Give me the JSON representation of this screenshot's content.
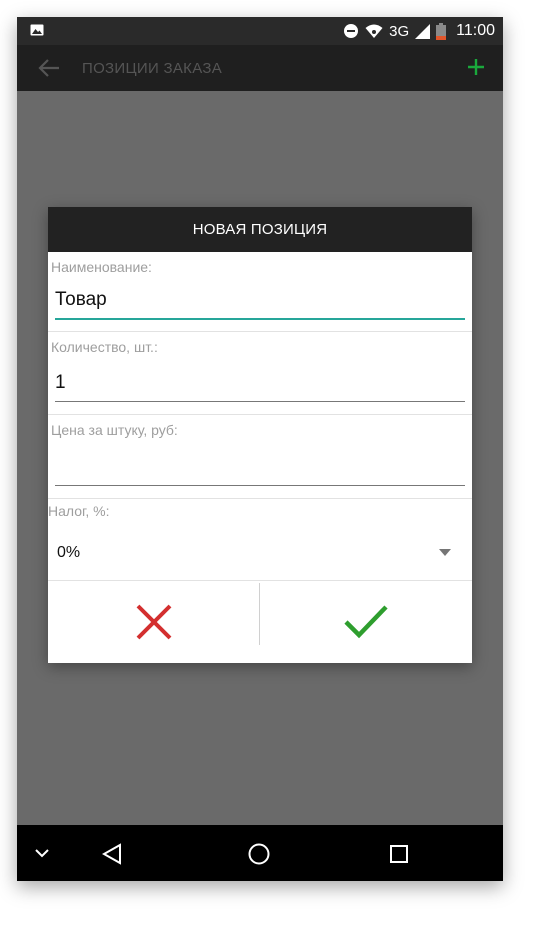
{
  "status_bar": {
    "network": "3G",
    "time": "11:00",
    "icons": [
      "gallery-icon",
      "dnd-icon",
      "wifi-icon",
      "signal-icon",
      "battery-icon"
    ]
  },
  "action_bar": {
    "title": "ПОЗИЦИИ ЗАКАЗА",
    "icons": [
      "back-arrow-icon",
      "plus-icon"
    ],
    "accent_color": "#1aa83c"
  },
  "dialog": {
    "title": "НОВАЯ ПОЗИЦИЯ",
    "fields": [
      {
        "label": "Наименование:",
        "value": "Товар",
        "placeholder": ""
      },
      {
        "label": "Количество, шт.:",
        "value": "1",
        "placeholder": ""
      },
      {
        "label": "Цена за штуку, руб:",
        "value": "",
        "placeholder": ""
      }
    ],
    "tax": {
      "label": "Налог, %:",
      "selected": "0%"
    },
    "buttons": {
      "cancel_icon": "cross-icon",
      "cancel_color": "#d32f2f",
      "ok_icon": "check-icon",
      "ok_color": "#2e9e2e"
    },
    "focus_color": "#26a69a"
  },
  "nav_bar": {
    "icons": [
      "chevron-down-icon",
      "back-triangle-icon",
      "home-circle-icon",
      "recents-square-icon"
    ]
  }
}
